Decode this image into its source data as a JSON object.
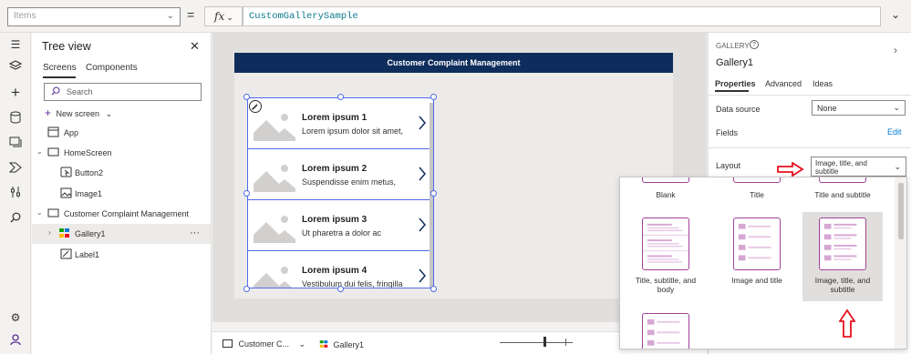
{
  "formula_bar": {
    "property": "Items",
    "equals": "=",
    "fx_label": "fx",
    "formula": "CustomGallerySample"
  },
  "tree": {
    "title": "Tree view",
    "tabs": [
      "Screens",
      "Components"
    ],
    "search_placeholder": "Search",
    "new_screen": "New screen",
    "rows": {
      "app": "App",
      "home_screen": "HomeScreen",
      "button2": "Button2",
      "image1": "Image1",
      "ccm_screen": "Customer Complaint Management",
      "gallery1": "Gallery1",
      "gallery_more": "···",
      "label1": "Label1"
    }
  },
  "canvas": {
    "header": "Customer Complaint Management",
    "items": [
      {
        "title": "Lorem ipsum 1",
        "subtitle": "Lorem ipsum dolor sit amet,"
      },
      {
        "title": "Lorem ipsum 2",
        "subtitle": "Suspendisse enim metus,"
      },
      {
        "title": "Lorem ipsum 3",
        "subtitle": "Ut pharetra a dolor ac"
      },
      {
        "title": "Lorem ipsum 4",
        "subtitle": "Vestibulum dui felis, fringilla"
      }
    ]
  },
  "bottom": {
    "screen_crumb": "Customer C...",
    "control_crumb": "Gallery1"
  },
  "props": {
    "control_type": "GALLERY",
    "control_name": "Gallery1",
    "tabs": [
      "Properties",
      "Advanced",
      "Ideas"
    ],
    "data_source_label": "Data source",
    "data_source_value": "None",
    "fields_label": "Fields",
    "fields_edit": "Edit",
    "layout_label": "Layout",
    "layout_value_line1": "Image, title, and",
    "layout_value_line2": "subtitle"
  },
  "layout_options": {
    "blank": "Blank",
    "title": "Title",
    "title_subtitle": "Title and subtitle",
    "title_subtitle_body_1": "Title, subtitle, and",
    "title_subtitle_body_2": "body",
    "image_title": "Image and title",
    "image_title_subtitle_1": "Image, title, and",
    "image_title_subtitle_2": "subtitle"
  },
  "colors": {
    "header_bg": "#0f2d5c",
    "selection": "#4f6bed",
    "thumb_accent": "#a1429b",
    "annotation": "#e8101c"
  }
}
